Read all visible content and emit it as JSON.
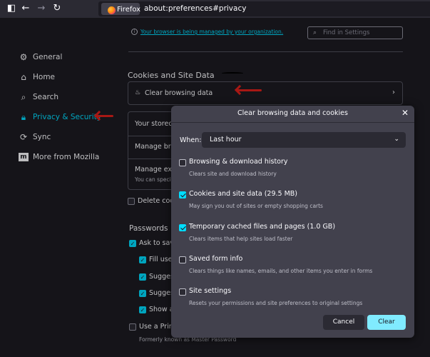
{
  "browser": {
    "identity_label": "Firefox",
    "url": "about:preferences#privacy"
  },
  "header": {
    "managed_notice": "Your browser is being managed by your organization.",
    "search_placeholder": "Find in Settings"
  },
  "sidebar": {
    "items": [
      {
        "label": "General",
        "icon": "gear-icon"
      },
      {
        "label": "Home",
        "icon": "home-icon"
      },
      {
        "label": "Search",
        "icon": "search-icon"
      },
      {
        "label": "Privacy & Security",
        "icon": "lock-icon",
        "active": true
      },
      {
        "label": "Sync",
        "icon": "sync-icon"
      },
      {
        "label": "More from Mozilla",
        "icon": "mozilla-icon"
      }
    ]
  },
  "main": {
    "section_title": "Cookies and Site Data",
    "clear_row_label": "Clear browsing data",
    "stored_text": "Your stored c",
    "manage_browsing": "Manage brows",
    "manage_exceptions": "Manage exce",
    "manage_exceptions_sub": "You can specif",
    "delete_cookies": "Delete cook",
    "passwords_title": "Passwords",
    "ask_to_save": "Ask to save",
    "fill_user": "Fill user",
    "suggest1": "Suggest",
    "suggest2": "Suggest",
    "show_al": "Show al",
    "use_primary": "Use a Prim",
    "formerly": "Formerly known as Master Password"
  },
  "dialog": {
    "title": "Clear browsing data and cookies",
    "when_label": "When:",
    "when_value": "Last hour",
    "options": [
      {
        "label": "Browsing & download history",
        "desc": "Clears site and download history",
        "checked": false
      },
      {
        "label": "Cookies and site data (29.5 MB)",
        "desc": "May sign you out of sites or empty shopping carts",
        "checked": true
      },
      {
        "label": "Temporary cached files and pages (1.0 GB)",
        "desc": "Clears items that help sites load faster",
        "checked": true
      },
      {
        "label": "Saved form info",
        "desc": "Clears things like names, emails, and other items you enter in forms",
        "checked": false
      },
      {
        "label": "Site settings",
        "desc": "Resets your permissions and site preferences to original settings",
        "checked": false
      }
    ],
    "cancel_label": "Cancel",
    "clear_label": "Clear"
  },
  "colors": {
    "accent": "#00ddff",
    "annotation_arrow": "#e0211b",
    "primary_button": "#80ebff"
  }
}
